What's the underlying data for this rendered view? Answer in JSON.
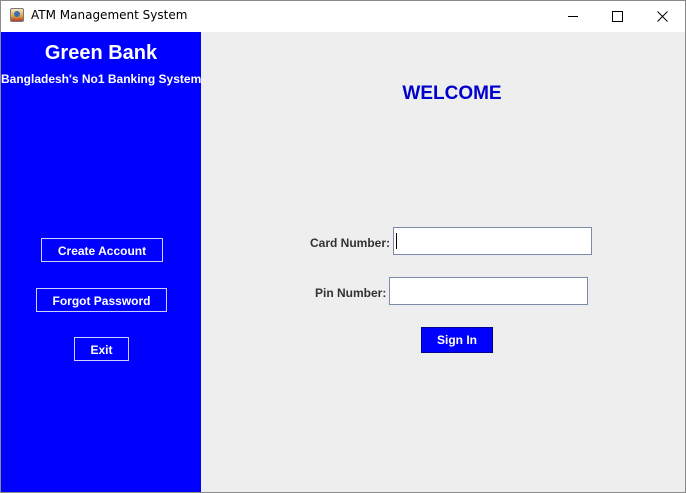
{
  "window": {
    "title": "ATM Management System"
  },
  "sidebar": {
    "bank_name": "Green Bank",
    "tagline": "Bangladesh's No1 Banking System",
    "buttons": {
      "create_account": "Create Account",
      "forgot_password": "Forgot Password",
      "exit": "Exit"
    },
    "background_color": "#0000ff"
  },
  "main": {
    "welcome_text": "WELCOME",
    "card_number_label": "Card Number:",
    "card_number_value": "",
    "pin_number_label": "Pin Number:",
    "pin_number_value": "",
    "sign_in_label": "Sign In",
    "background_color": "#eeeeee"
  },
  "icons": {
    "app": "java-app-icon",
    "minimize": "minimize-icon",
    "maximize": "maximize-icon",
    "close": "close-icon"
  }
}
